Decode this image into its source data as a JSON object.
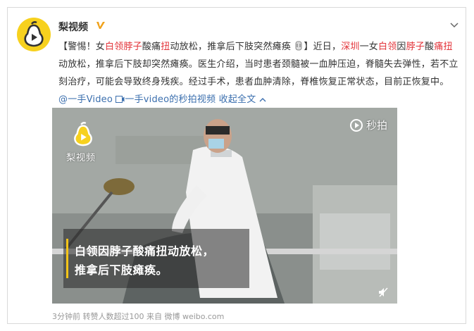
{
  "post": {
    "username": "梨视频",
    "verified_badge": "verified-v-badge",
    "more_menu": "chevron-down-icon",
    "text": {
      "s1": "【警惕！女",
      "s2": "白领脖子",
      "s3": "酸痛",
      "s4": "扭",
      "s5": "动放松，推拿后下肢突然瘫痪",
      "s6": "】近日，",
      "s7": "深圳",
      "s8": "一女",
      "s9": "白领",
      "s10": "因",
      "s11": "脖子",
      "s12": "酸",
      "s13": "痛",
      "s14": "扭",
      "s15": "动放松，推拿后下肢却突然瘫痪。医生介绍，当时患者颈髓被一血肿压迫，脊髓失去弹性，若不立刻治疗，可能会导致终身残疾。经过手术，患者血肿清除，脊椎恢复正常状态，目前正恢复中。",
      "mention": "@一手Video",
      "video_link": "一手video的秒拍视频",
      "expand": "收起全文"
    }
  },
  "video": {
    "watermark_text": "梨视频",
    "miaopai_label": "秒拍",
    "caption_line1": "白领因脖子酸痛扭动放松，",
    "caption_line2": "推拿后下肢瘫痪。"
  },
  "footer": {
    "meta": "3分钟前 转赞人数超过100  来自 微博 weibo.com"
  },
  "colors": {
    "highlight": "#e3343a",
    "link": "#3b6fae",
    "brand_yellow": "#f7d11e"
  }
}
